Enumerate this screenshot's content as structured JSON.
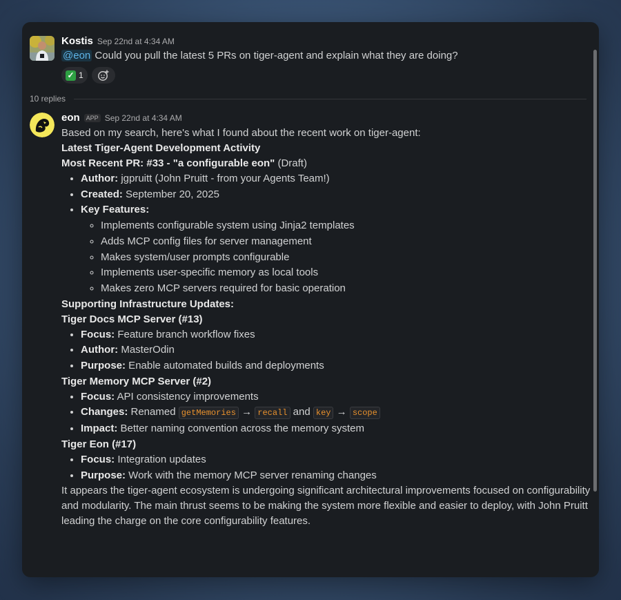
{
  "thread": {
    "replies_label": "10 replies"
  },
  "message1": {
    "author": "Kostis",
    "timestamp": "Sep 22nd at 4:34 AM",
    "mention": "@eon",
    "text": " Could you pull the latest 5 PRs on tiger-agent and explain what they are doing?",
    "reactions": [
      {
        "emoji": "white-check-mark-icon",
        "count": "1"
      }
    ]
  },
  "message2": {
    "author": "eon",
    "badge": "APP",
    "timestamp": "Sep 22nd at 4:34 AM",
    "intro": "Based on my search, here's what I found about the recent work on tiger-agent:",
    "heading": "Latest Tiger-Agent Development Activity",
    "recent_pr": {
      "prefix": "Most Recent PR: #33 - \"a configurable eon\"",
      "suffix": " (Draft)",
      "author_label": "Author:",
      "author_value": " jgpruitt (John Pruitt - from your Agents Team!)",
      "created_label": "Created:",
      "created_value": " September 20, 2025",
      "features_label": "Key Features:",
      "features": [
        "Implements configurable system using Jinja2 templates",
        "Adds MCP config files for server management",
        "Makes system/user prompts configurable",
        "Implements user-specific memory as local tools",
        "Makes zero MCP servers required for basic operation"
      ]
    },
    "infra_heading": "Supporting Infrastructure Updates:",
    "docs": {
      "title": "Tiger Docs MCP Server (#13)",
      "focus_label": "Focus:",
      "focus_value": " Feature branch workflow fixes",
      "author_label": "Author:",
      "author_value": " MasterOdin",
      "purpose_label": "Purpose:",
      "purpose_value": " Enable automated builds and deployments"
    },
    "memory": {
      "title": "Tiger Memory MCP Server (#2)",
      "focus_label": "Focus:",
      "focus_value": " API consistency improvements",
      "changes_label": "Changes:",
      "changes_renamed": " Renamed ",
      "code1": "getMemories",
      "arrow1": " → ",
      "code2": "recall",
      "and": " and ",
      "code3": "key",
      "arrow2": " → ",
      "code4": "scope",
      "impact_label": "Impact:",
      "impact_value": " Better naming convention across the memory system"
    },
    "eon": {
      "title": "Tiger Eon (#17)",
      "focus_label": "Focus:",
      "focus_value": " Integration updates",
      "purpose_label": "Purpose:",
      "purpose_value": " Work with the memory MCP server renaming changes"
    },
    "conclusion": "It appears the tiger-agent ecosystem is undergoing significant architectural improvements focused on configurability and modularity. The main thrust seems to be making the system more flexible and easier to deploy, with John Pruitt leading the charge on the core configurability features."
  }
}
